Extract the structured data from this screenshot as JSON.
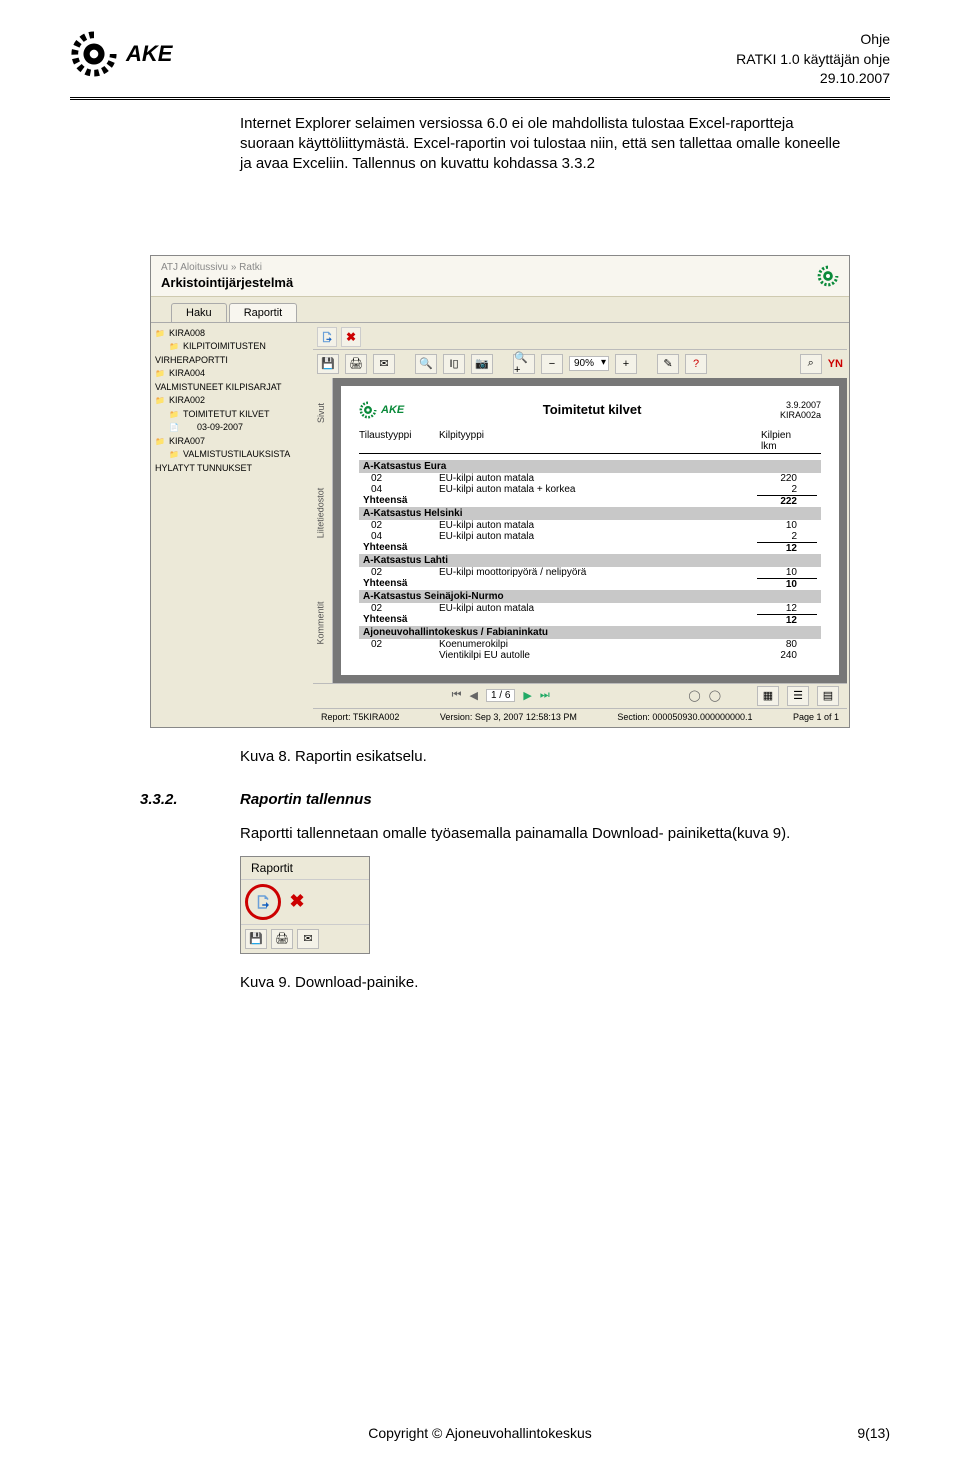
{
  "header": {
    "brand": "AKE",
    "right_line1": "Ohje",
    "right_line2": "RATKI 1.0 käyttäjän ohje",
    "right_line3": "29.10.2007"
  },
  "body_paragraph": "Internet Explorer selaimen versiossa 6.0 ei ole mahdollista tulostaa Excel-raportteja suoraan käyttöliittymästä. Excel-raportin voi tulostaa niin, että sen tallettaa omalle koneelle ja avaa Exceliin. Tallennus on kuvattu kohdassa 3.3.2",
  "screenshot1": {
    "breadcrumb": "ATJ Aloitussivu » Ratki",
    "title": "Arkistointijärjestelmä",
    "tabs": [
      "Haku",
      "Raportit"
    ],
    "tree": [
      {
        "label": "KIRA008",
        "type": "folder",
        "indent": 0
      },
      {
        "label": "KILPITOIMITUSTEN",
        "type": "folder",
        "indent": 1
      },
      {
        "label": "VIRHERAPORTTI",
        "type": "noicon",
        "indent": -1
      },
      {
        "label": "KIRA004",
        "type": "folder",
        "indent": 0
      },
      {
        "label": "VALMISTUNEET KILPISARJAT",
        "type": "noicon",
        "indent": -1
      },
      {
        "label": "KIRA002",
        "type": "folder",
        "indent": 0
      },
      {
        "label": "TOIMITETUT KILVET",
        "type": "folder",
        "indent": 1
      },
      {
        "label": "03-09-2007",
        "type": "doc",
        "indent": 2
      },
      {
        "label": "KIRA007",
        "type": "folder",
        "indent": 0
      },
      {
        "label": "VALMISTUSTILAUKSISTA",
        "type": "folder",
        "indent": 1
      },
      {
        "label": "HYLATYT TUNNUKSET",
        "type": "noicon",
        "indent": -1
      }
    ],
    "toolbar2": {
      "zoom": "90%",
      "yahoo": "YN"
    },
    "sidetabs": [
      "Sivut",
      "Liitetiedostot",
      "Kommentit"
    ],
    "paper": {
      "brand": "AKE",
      "title": "Toimitetut kilvet",
      "date": "3.9.2007",
      "code": "KIRA002a",
      "col_headers": [
        "Tilaustyyppi",
        "Kilpityyppi",
        "Kilpien lkm"
      ],
      "sections": [
        {
          "name": "A-Katsastus Eura",
          "rows": [
            {
              "a": "02",
              "b": "EU-kilpi auton matala",
              "c": "220"
            },
            {
              "a": "04",
              "b": "EU-kilpi auton matala + korkea",
              "c": "2"
            }
          ],
          "total_label": "Yhteensä",
          "total": "222"
        },
        {
          "name": "A-Katsastus Helsinki",
          "rows": [
            {
              "a": "02",
              "b": "EU-kilpi auton matala",
              "c": "10"
            },
            {
              "a": "04",
              "b": "EU-kilpi auton matala",
              "c": "2"
            }
          ],
          "total_label": "Yhteensä",
          "total": "12"
        },
        {
          "name": "A-Katsastus Lahti",
          "rows": [
            {
              "a": "02",
              "b": "EU-kilpi moottoripyörä / nelipyörä",
              "c": "10"
            }
          ],
          "total_label": "Yhteensä",
          "total": "10"
        },
        {
          "name": "A-Katsastus Seinäjoki-Nurmo",
          "rows": [
            {
              "a": "02",
              "b": "EU-kilpi auton matala",
              "c": "12"
            }
          ],
          "total_label": "Yhteensä",
          "total": "12"
        },
        {
          "name": "Ajoneuvohallintokeskus / Fabianinkatu",
          "rows": [
            {
              "a": "02",
              "b": "Koenumerokilpi",
              "c": "80"
            },
            {
              "a": "",
              "b": "Vientikilpi EU autolle",
              "c": "240"
            }
          ],
          "total_label": "",
          "total": ""
        }
      ]
    },
    "nav": {
      "page": "1 / 6"
    },
    "status": {
      "report": "Report: T5KIRA002",
      "version": "Version: Sep 3, 2007 12:58:13 PM",
      "section": "Section: 000050930.000000000.1",
      "page": "Page 1 of 1"
    }
  },
  "caption1": "Kuva 8. Raportin esikatselu.",
  "section332": {
    "num": "3.3.2.",
    "title": "Raportin tallennus",
    "text": "Raportti tallennetaan omalle työasemalla painamalla Download- painiketta(kuva 9)."
  },
  "screenshot2": {
    "tab": "Raportit"
  },
  "caption2": "Kuva 9. Download-painike.",
  "footer": "Copyright © Ajoneuvohallintokeskus",
  "pagenum": "9(13)"
}
